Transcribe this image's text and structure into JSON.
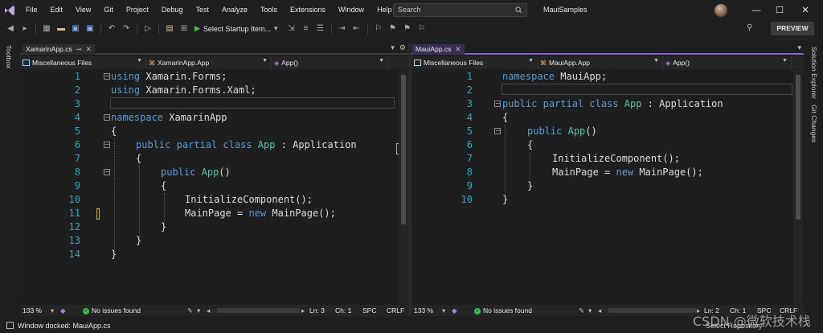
{
  "menu": [
    "File",
    "Edit",
    "View",
    "Git",
    "Project",
    "Debug",
    "Test",
    "Analyze",
    "Tools",
    "Extensions",
    "Window",
    "Help"
  ],
  "search": {
    "placeholder": "Search"
  },
  "solution_name": "MauiSamples",
  "window_buttons": {
    "minimize": "—",
    "maximize": "☐",
    "close": "✕"
  },
  "toolbar": {
    "startup_label": "Select Startup Item...",
    "preview_label": "PREVIEW"
  },
  "left_strip": {
    "toolbox": "Toolbox"
  },
  "right_strip": {
    "solution_explorer": "Solution Explorer",
    "git_changes": "Git Changes"
  },
  "left_pane": {
    "tab": "XamarinApp.cs",
    "nav": {
      "project": "Miscellaneous Files",
      "class": "XamarinApp.App",
      "member": "App()"
    },
    "line_numbers": [
      "1",
      "2",
      "3",
      "4",
      "5",
      "6",
      "7",
      "8",
      "9",
      "10",
      "11",
      "12",
      "13",
      "14"
    ],
    "status": {
      "zoom": "133 %",
      "issues": "No issues found",
      "ln": "Ln: 3",
      "ch": "Ch: 1",
      "spc": "SPC",
      "crlf": "CRLF"
    }
  },
  "right_pane": {
    "tab": "MauiApp.cs",
    "nav": {
      "project": "Miscellaneous Files",
      "class": "MauiApp.App",
      "member": "App()"
    },
    "line_numbers": [
      "1",
      "2",
      "3",
      "4",
      "5",
      "6",
      "7",
      "8",
      "9",
      "10"
    ],
    "status": {
      "zoom": "133 %",
      "issues": "No issues found",
      "ln": "Ln: 2",
      "ch": "Ch: 1",
      "spc": "SPC",
      "crlf": "CRLF"
    }
  },
  "code_tokens": {
    "using": "using",
    "namespace": "namespace",
    "public": "public",
    "partial": "partial",
    "class": "class",
    "new": "new",
    "xf": " Xamarin.Forms;",
    "xfx": " Xamarin.Forms.Xaml;",
    "xns": " XamarinApp",
    "mns": " MauiApp;",
    "app": "App",
    "app_paren": "App",
    "colon_application": " : Application",
    "paren": "()",
    "open": "{",
    "close": "}",
    "init": "InitializeComponent();",
    "mainpage": "MainPage = ",
    "mainpage_new": " MainPage();"
  },
  "status_bar": {
    "message": "Window docked: MauiApp.cs",
    "repo": "Select Repository"
  },
  "watermark": "CSDN @微软技术栈"
}
